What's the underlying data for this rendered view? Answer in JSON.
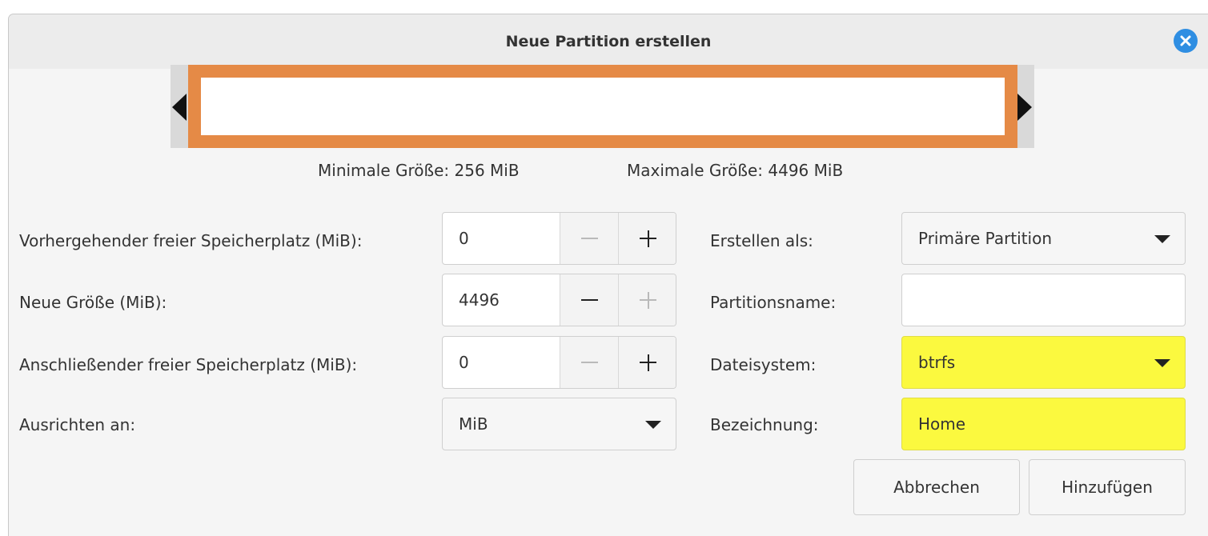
{
  "dialog": {
    "title": "Neue Partition erstellen",
    "close_icon": "close-icon"
  },
  "partition_graphic": {
    "fill_fraction": 1.0,
    "bar_color": "#e58a46",
    "left_handle_icon": "arrow-left-handle-icon",
    "right_handle_icon": "arrow-right-handle-icon"
  },
  "size_info": {
    "min": "Minimale Größe: 256 MiB",
    "max": "Maximale Größe: 4496 MiB"
  },
  "fields": {
    "preceding": {
      "label": "Vorhergehender freier Speicherplatz (MiB):",
      "value": "0"
    },
    "new_size": {
      "label": "Neue Größe (MiB):",
      "value": "4496"
    },
    "following": {
      "label": "Anschließender freier Speicherplatz (MiB):",
      "value": "0"
    },
    "align": {
      "label": "Ausrichten an:",
      "value": "MiB"
    }
  },
  "right": {
    "create_as": {
      "label": "Erstellen als:",
      "value": "Primäre Partition"
    },
    "partition_name": {
      "label": "Partitionsname:",
      "value": ""
    },
    "filesystem": {
      "label": "Dateisystem:",
      "value": "btrfs"
    },
    "label_field": {
      "label": "Bezeichnung:",
      "value": "Home"
    }
  },
  "buttons": {
    "cancel": "Abbrechen",
    "add": "Hinzufügen"
  },
  "colors": {
    "highlight": "#fbf93f",
    "close_button": "#2f8ee2"
  }
}
